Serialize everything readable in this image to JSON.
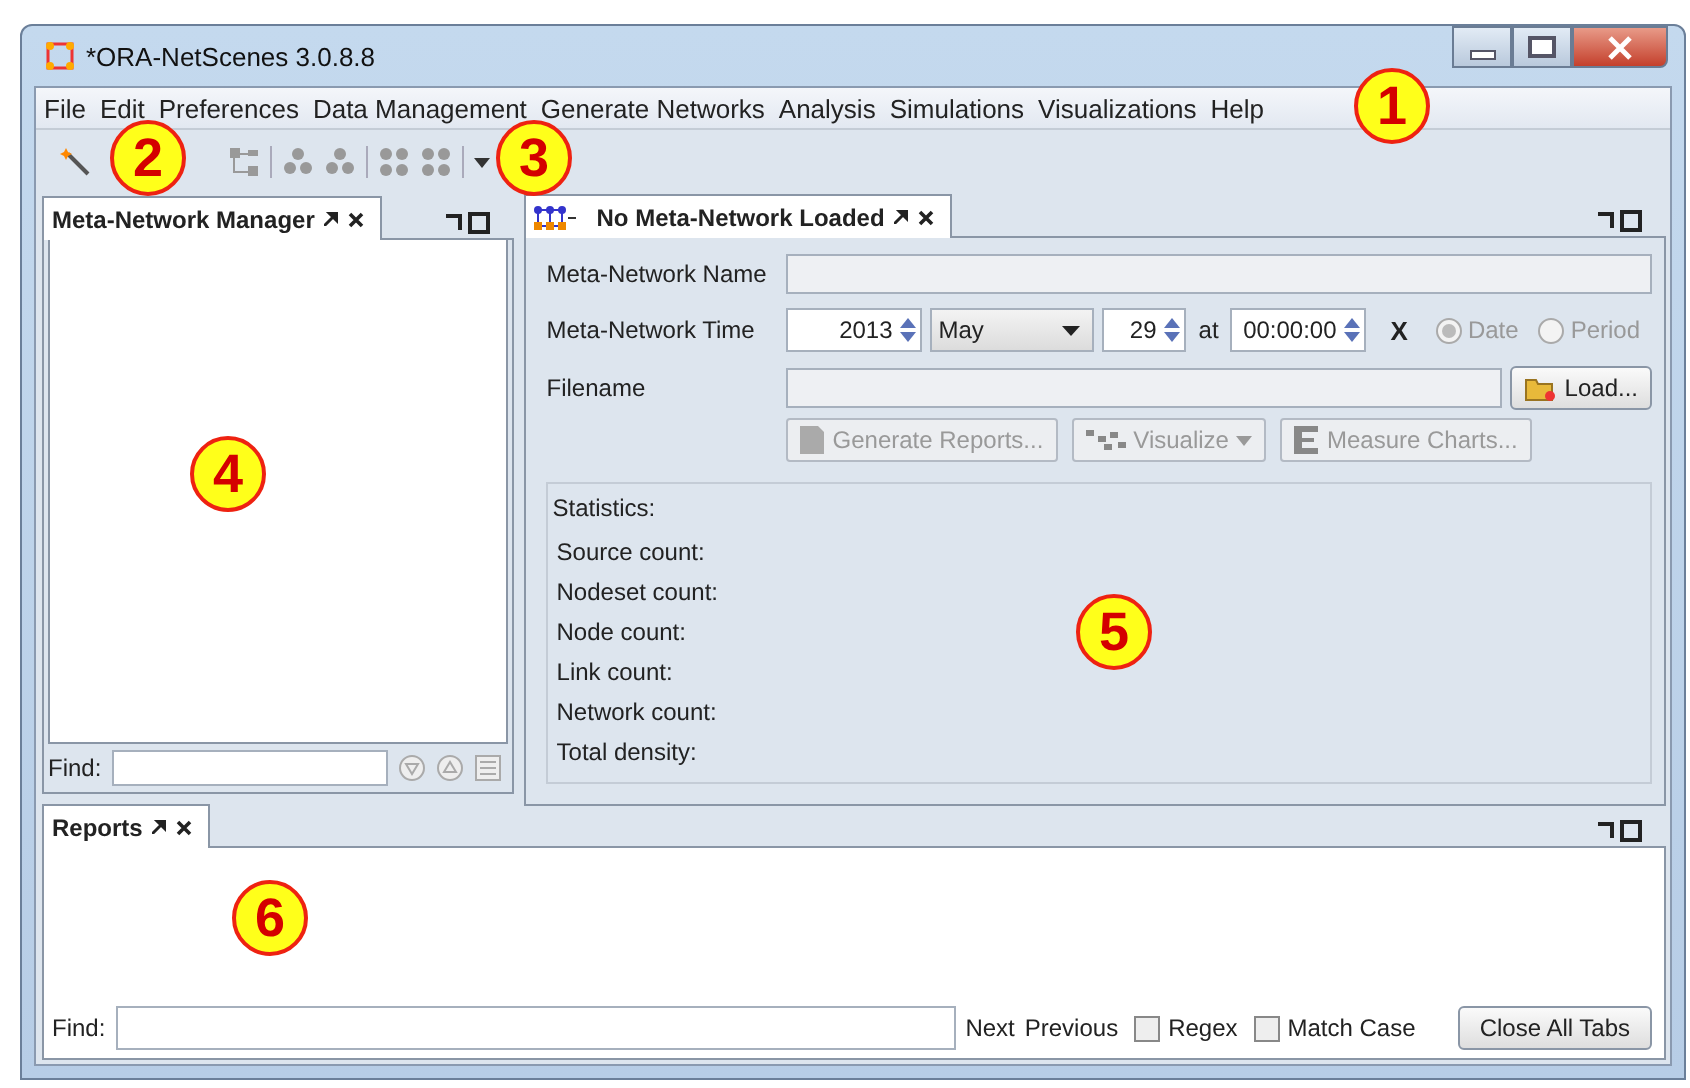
{
  "window": {
    "title": "*ORA-NetScenes 3.0.8.8"
  },
  "menu": [
    "File",
    "Edit",
    "Preferences",
    "Data Management",
    "Generate Networks",
    "Analysis",
    "Simulations",
    "Visualizations",
    "Help"
  ],
  "callouts": [
    "1",
    "2",
    "3",
    "4",
    "5",
    "6"
  ],
  "manager": {
    "tab": "Meta-Network Manager",
    "find_label": "Find:"
  },
  "editor": {
    "tab": "No Meta-Network Loaded",
    "name_label": "Meta-Network Name",
    "time_label": "Meta-Network Time",
    "year": "2013",
    "month": "May",
    "day": "29",
    "at": "at",
    "time": "00:00:00",
    "clear": "X",
    "radios": [
      {
        "label": "Date",
        "selected": true
      },
      {
        "label": "Period",
        "selected": false
      }
    ],
    "filename_label": "Filename",
    "load": "Load...",
    "actions": [
      "Generate Reports...",
      "Visualize",
      "Measure Charts..."
    ],
    "statistics_title": "Statistics:",
    "statistics": [
      "Source count:",
      "Nodeset count:",
      "Node count:",
      "Link count:",
      "Network count:",
      "Total density:"
    ]
  },
  "reports": {
    "tab": "Reports",
    "find_label": "Find:",
    "next": "Next",
    "previous": "Previous",
    "options": [
      {
        "label": "Regex",
        "checked": false
      },
      {
        "label": "Match Case",
        "checked": false
      }
    ],
    "close_all": "Close All Tabs"
  }
}
